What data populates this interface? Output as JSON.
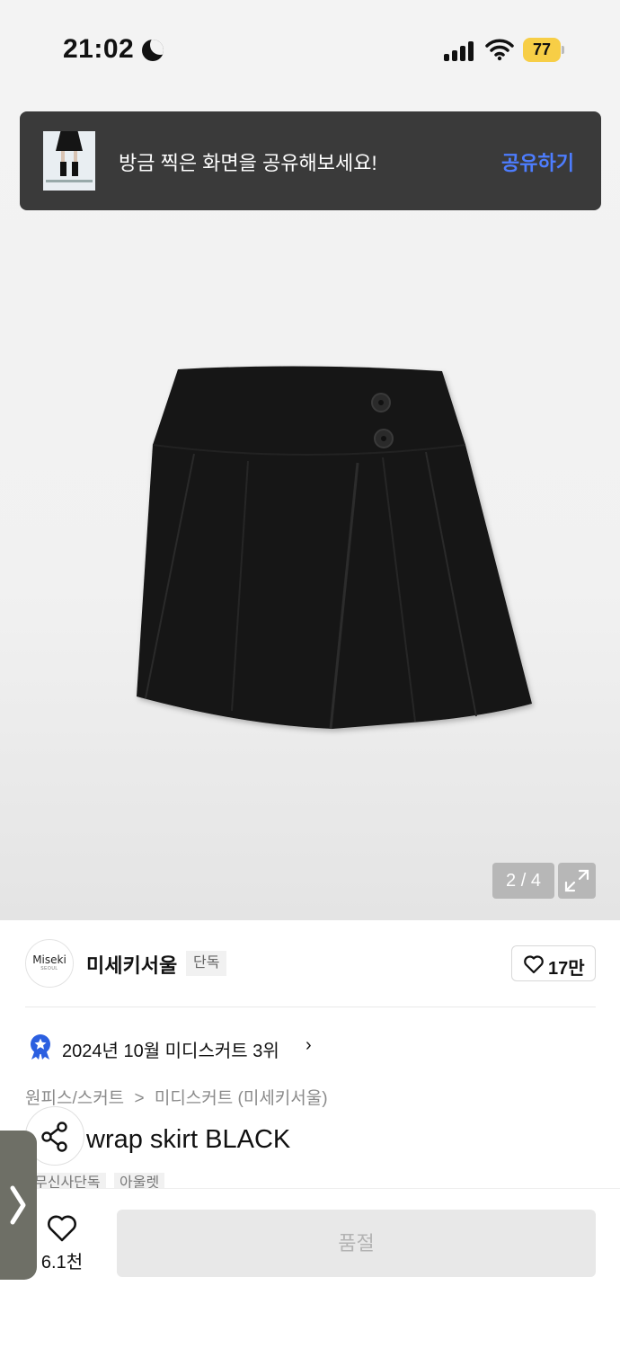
{
  "status_bar": {
    "time": "21:02",
    "battery": "77"
  },
  "toast": {
    "message": "방금 찍은 화면을 공유해보세요!",
    "action": "공유하기"
  },
  "gallery": {
    "counter": "2 / 4"
  },
  "brand": {
    "logo_text": "Miseki",
    "logo_sub": "SEOUL",
    "name": "미세키서울",
    "tag": "단독",
    "likes": "17만"
  },
  "ranking": {
    "text": "2024년 10월 미디스커트 3위"
  },
  "breadcrumb": {
    "category": "원피스/스커트",
    "separator": ">",
    "subcategory": "미디스커트 (미세키서울)"
  },
  "product": {
    "title": "wrap skirt BLACK",
    "tags": [
      "무신사단독",
      "아울렛"
    ]
  },
  "bottom": {
    "wish_count": "6.1천",
    "buy_label": "품절"
  },
  "colors": {
    "toast_bg": "#3a3a3a",
    "toast_action": "#4d7dff",
    "badge_blue": "#2b5fe0",
    "battery_yellow": "#f7ce46"
  },
  "icons": [
    "moon-icon",
    "signal-icon",
    "wifi-icon",
    "battery-icon",
    "expand-icon",
    "heart-icon",
    "ranking-badge-icon",
    "chevron-right-icon",
    "share-icon",
    "chevron-right-handle-icon"
  ]
}
